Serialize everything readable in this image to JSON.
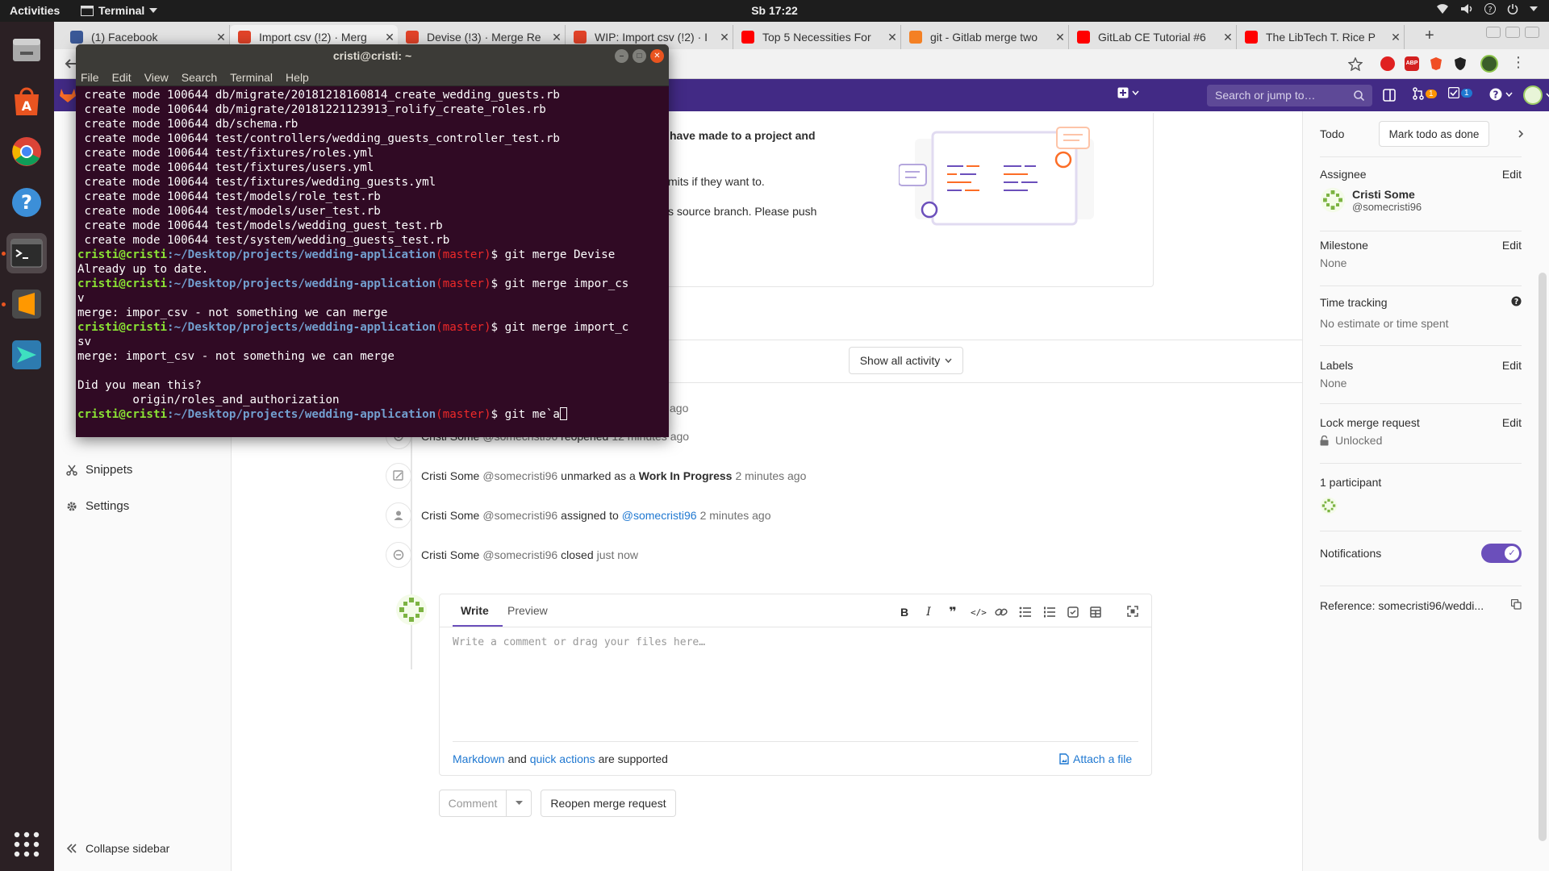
{
  "topbar": {
    "activities": "Activities",
    "app_menu": "Terminal",
    "clock": "Sb 17:22"
  },
  "dock": {
    "apps": [
      {
        "icon": "files-icon"
      },
      {
        "icon": "ubuntu-software-icon"
      },
      {
        "icon": "chrome-icon"
      },
      {
        "icon": "help-icon"
      },
      {
        "icon": "terminal-icon"
      },
      {
        "icon": "sublime-text-icon"
      },
      {
        "icon": "remote-desktop-icon"
      }
    ]
  },
  "browser": {
    "tabs": [
      {
        "title": "(1) Facebook",
        "favicon": "facebook-icon",
        "color": "#3b5998"
      },
      {
        "title": "Import csv (!2) · Merg",
        "favicon": "gitlab-icon",
        "color": "#e24329"
      },
      {
        "title": "Devise (!3) · Merge Re",
        "favicon": "gitlab-icon",
        "color": "#e24329"
      },
      {
        "title": "WIP: Import csv (!2) · I",
        "favicon": "gitlab-icon",
        "color": "#e24329"
      },
      {
        "title": "Top 5 Necessities For",
        "favicon": "youtube-icon",
        "color": "#ff0000"
      },
      {
        "title": "git - Gitlab merge two",
        "favicon": "stackoverflow-icon",
        "color": "#f48024"
      },
      {
        "title": "GitLab CE Tutorial #6",
        "favicon": "youtube-icon",
        "color": "#ff0000"
      },
      {
        "title": "The LibTech T. Rice P",
        "favicon": "youtube-icon",
        "color": "#ff0000"
      }
    ],
    "new_tab": "+"
  },
  "gitlab": {
    "search_placeholder": "Search or jump to…",
    "mr_count": "1",
    "todo_count": "1",
    "sidebar": {
      "snippets": "Snippets",
      "settings": "Settings",
      "collapse": "Collapse sidebar"
    },
    "banner": {
      "line1": "have made to a project and",
      "line2": "mits if they want to.",
      "line3": "s source branch. Please push"
    },
    "activity_filter": "Show all activity",
    "events": [
      {
        "author": "Cristi Some",
        "handle": "@somecristi96",
        "action": "reopened",
        "time": "12 minutes ago",
        "icon": "eye-icon"
      },
      {
        "author": "Cristi Some",
        "handle": "@somecristi96",
        "action": "unmarked as a",
        "bold": "Work In Progress",
        "time": "2 minutes ago",
        "icon": "pencil-icon"
      },
      {
        "author": "Cristi Some",
        "handle": "@somecristi96",
        "action": "assigned to",
        "link": "@somecristi96",
        "time": "2 minutes ago",
        "icon": "user-icon"
      },
      {
        "author": "Cristi Some",
        "handle": "@somecristi96",
        "action": "closed",
        "time": "just now",
        "icon": "closed-icon"
      }
    ],
    "first_event_time": "ago",
    "comment": {
      "write_tab": "Write",
      "preview_tab": "Preview",
      "placeholder": "Write a comment or drag your files here…",
      "markdown": "Markdown",
      "and": "and",
      "quick_actions": "quick actions",
      "supported": "are supported",
      "attach": "Attach a file",
      "comment_button": "Comment",
      "reopen_button": "Reopen merge request"
    },
    "right_sidebar": {
      "todo": "Todo",
      "mark_done": "Mark todo as done",
      "assignee_label": "Assignee",
      "edit": "Edit",
      "assignee_name": "Cristi Some",
      "assignee_handle": "@somecristi96",
      "milestone_label": "Milestone",
      "milestone_value": "None",
      "time_label": "Time tracking",
      "time_value": "No estimate or time spent",
      "labels_label": "Labels",
      "labels_value": "None",
      "lock_label": "Lock merge request",
      "lock_value": "Unlocked",
      "participants": "1 participant",
      "notifications": "Notifications",
      "reference": "Reference: somecristi96/weddi..."
    }
  },
  "terminal": {
    "title": "cristi@cristi: ~",
    "menu": [
      "File",
      "Edit",
      "View",
      "Search",
      "Terminal",
      "Help"
    ],
    "lines": [
      {
        "text": " create mode 100644 db/migrate/20181218160814_create_wedding_guests.rb"
      },
      {
        "text": " create mode 100644 db/migrate/20181221123913_rolify_create_roles.rb"
      },
      {
        "text": " create mode 100644 db/schema.rb"
      },
      {
        "text": " create mode 100644 test/controllers/wedding_guests_controller_test.rb"
      },
      {
        "text": " create mode 100644 test/fixtures/roles.yml"
      },
      {
        "text": " create mode 100644 test/fixtures/users.yml"
      },
      {
        "text": " create mode 100644 test/fixtures/wedding_guests.yml"
      },
      {
        "text": " create mode 100644 test/models/role_test.rb"
      },
      {
        "text": " create mode 100644 test/models/user_test.rb"
      },
      {
        "text": " create mode 100644 test/models/wedding_guest_test.rb"
      },
      {
        "text": " create mode 100644 test/system/wedding_guests_test.rb"
      },
      {
        "prompt": true,
        "cmd": " git merge Devise"
      },
      {
        "text": "Already up to date."
      },
      {
        "prompt": true,
        "cmd": " git merge impor_cs"
      },
      {
        "text": "v"
      },
      {
        "text": "merge: impor_csv - not something we can merge"
      },
      {
        "prompt": true,
        "cmd": " git merge import_c"
      },
      {
        "text": "sv"
      },
      {
        "text": "merge: import_csv - not something we can merge"
      },
      {
        "text": ""
      },
      {
        "text": "Did you mean this?"
      },
      {
        "text": "        origin/roles_and_authorization"
      },
      {
        "prompt": true,
        "cmd": " git me`a",
        "cursor": true
      }
    ],
    "prompt_user": "cristi@cristi",
    "prompt_path": ":~/Desktop/projects/wedding-application",
    "prompt_branch": "(master)",
    "prompt_sign": "$"
  }
}
